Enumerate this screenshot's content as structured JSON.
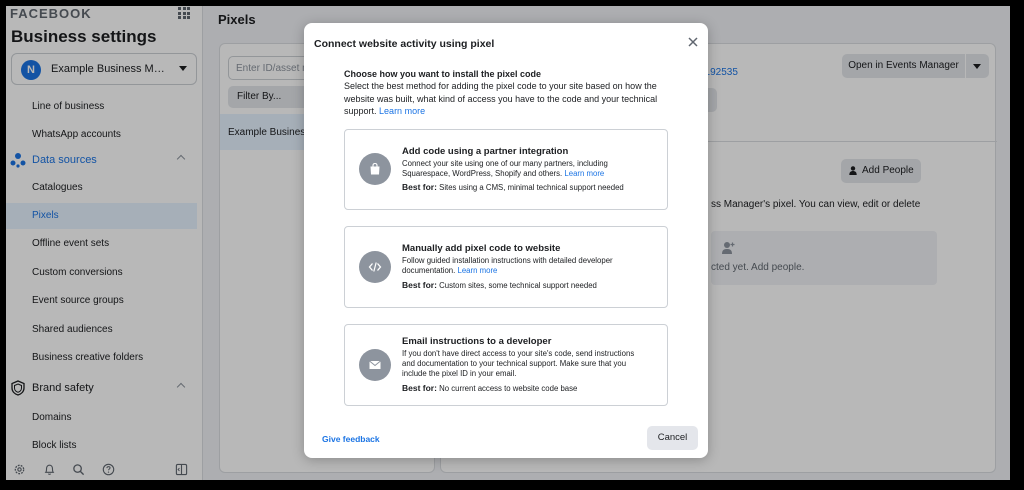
{
  "sidebar": {
    "brand": "FACEBOOK",
    "title": "Business settings",
    "account": {
      "initial": "N",
      "name": "Example Business Manag..."
    },
    "items": [
      {
        "label": "Line of business"
      },
      {
        "label": "WhatsApp accounts"
      },
      {
        "label": "Data sources",
        "section": true
      },
      {
        "label": "Catalogues"
      },
      {
        "label": "Pixels",
        "active": true
      },
      {
        "label": "Offline event sets"
      },
      {
        "label": "Custom conversions"
      },
      {
        "label": "Event source groups"
      },
      {
        "label": "Shared audiences"
      },
      {
        "label": "Business creative folders"
      },
      {
        "label": "Brand safety",
        "section": true
      },
      {
        "label": "Domains"
      },
      {
        "label": "Block lists"
      }
    ],
    "bottom_icons": [
      "gear-icon",
      "bell-icon",
      "search-icon",
      "help-icon",
      "sidebar-toggle-icon"
    ]
  },
  "main": {
    "page_title": "Pixels",
    "search_placeholder": "Enter ID/asset na",
    "filter_label": "Filter By...",
    "pixel_row_label": "Example Busines",
    "pixel_id_partial": "3192535",
    "open_events_manager": "Open in Events Manager",
    "add_people": "Add People",
    "description_partial": "ss Manager's pixel. You can view, edit or delete",
    "empty_text_partial": "cted yet. Add people."
  },
  "modal": {
    "title": "Connect website activity using pixel",
    "heading": "Choose how you want to install the pixel code",
    "description": "Select the best method for adding the pixel code to your site based on how the website was built, what kind of access you have to the code and your technical support.",
    "learn_more": "Learn more",
    "options": [
      {
        "icon": "shopping-bag-icon",
        "title": "Add code using a partner integration",
        "description": "Connect your site using one of our many partners, including Squarespace, WordPress, Shopify and others.",
        "learn_more": "Learn more",
        "best_for_label": "Best for:",
        "best_for": "Sites using a CMS, minimal technical support needed"
      },
      {
        "icon": "code-icon",
        "title": "Manually add pixel code to website",
        "description": "Follow guided installation instructions with detailed developer documentation.",
        "learn_more": "Learn more",
        "best_for_label": "Best for:",
        "best_for": "Custom sites, some technical support needed"
      },
      {
        "icon": "envelope-icon",
        "title": "Email instructions to a developer",
        "description": "If you don't have direct access to your site's code, send instructions and documentation to your technical support. Make sure that you include the pixel ID in your email.",
        "best_for_label": "Best for:",
        "best_for": "No current access to website code base"
      }
    ],
    "feedback": "Give feedback",
    "cancel": "Cancel"
  },
  "colors": {
    "accent": "#1b74e4",
    "overlay": "rgba(0,0,0,0.28)",
    "icon_circle": "#8d949e"
  }
}
